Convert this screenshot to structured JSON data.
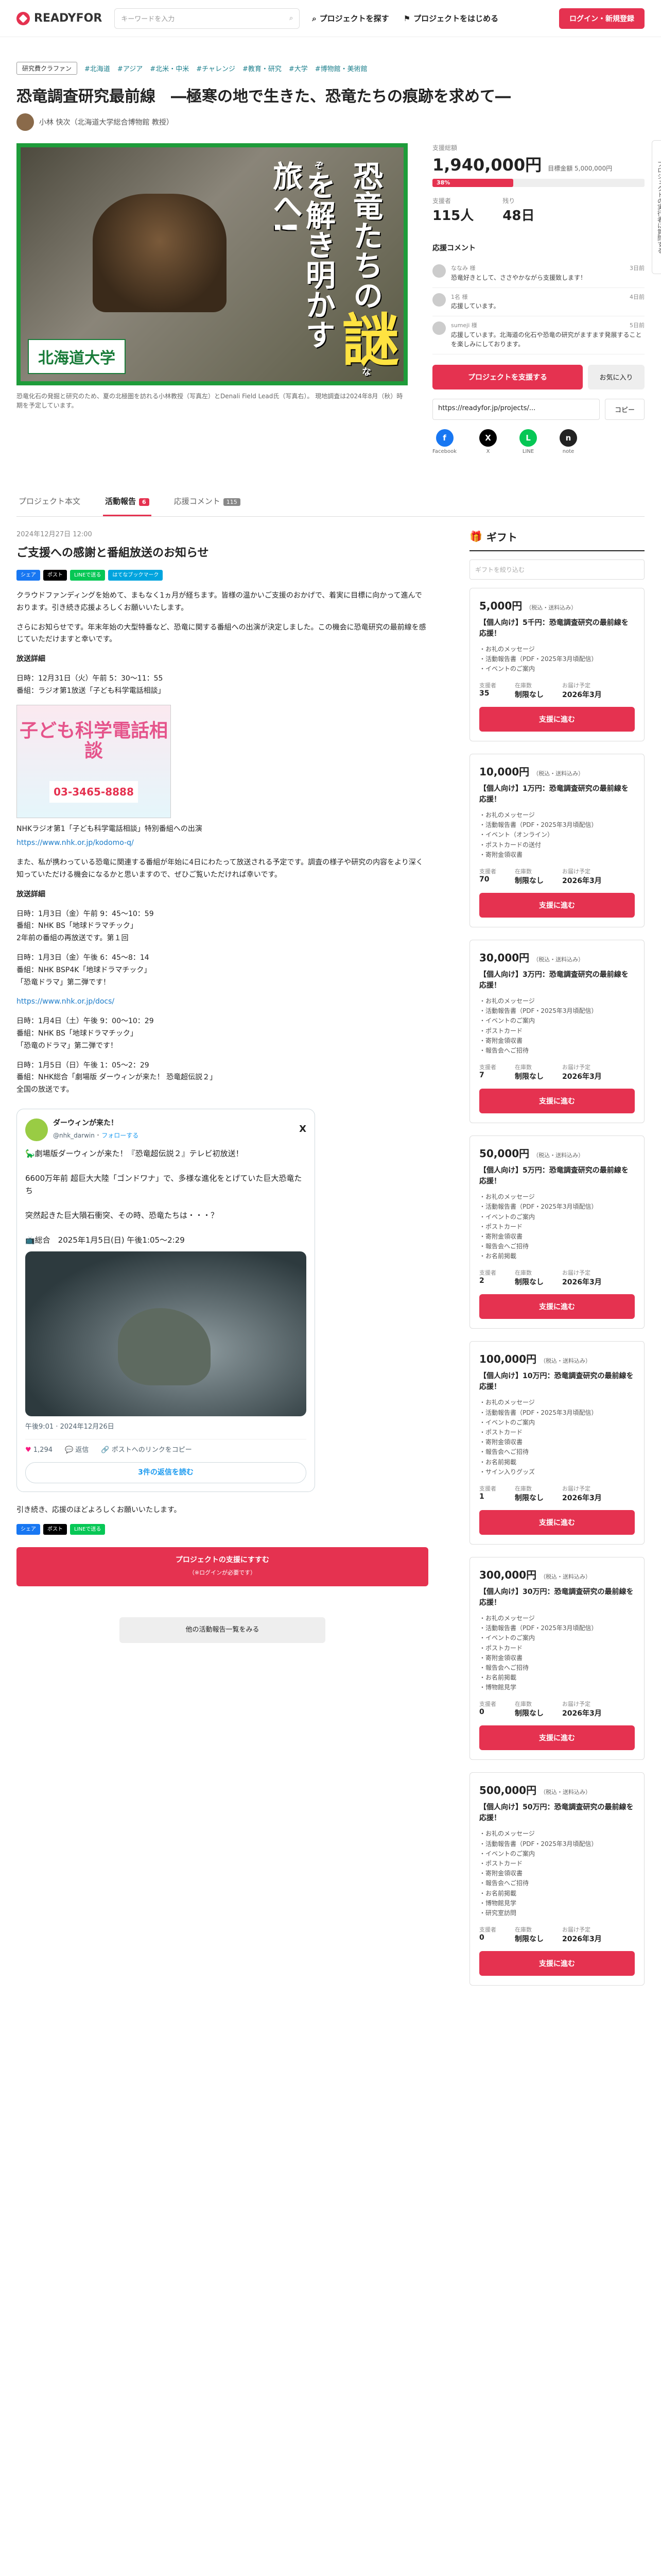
{
  "header": {
    "logo": "READYFOR",
    "search_placeholder": "キーワードを入力",
    "nav": [
      "プロジェクトを探す",
      "プロジェクトをはじめる"
    ],
    "login": "ログイン・新規登録"
  },
  "project": {
    "category": "研究費クラファン",
    "tags": [
      "#北海道",
      "#アジア",
      "#北米・中米",
      "#チャレンジ",
      "#教育・研究",
      "#大学",
      "#博物館・美術館"
    ],
    "title": "恐竜調査研究最前線　―極寒の地で生きた、恐竜たちの痕跡を求めて―",
    "owner": "小林 快次（北海道大学総合博物館 教授）",
    "hero_text": [
      "恐竜たちの",
      "謎",
      "を",
      "解き明かす旅へ!"
    ],
    "hero_ruby": "なぞ",
    "hero_badge": "北海道大学",
    "caption": "恐竜化石の発掘と研究のため、夏の北極圏を訪れる小林教授（写真左）とDenali Field Lead氏（写真右）。 現地調査は2024年8月（秋）時期を予定しています。",
    "float_label": "プロジェクトの実行者に質問する"
  },
  "status": {
    "amount_label": "支援総額",
    "amount": "1,940,000円",
    "goal": "目標金額 5,000,000円",
    "percent": 38,
    "percent_text": "38%",
    "supporters_label": "支援者",
    "supporters": "115人",
    "remaining_label": "残り",
    "remaining": "48日",
    "comments_title": "応援コメント",
    "comments": [
      {
        "name": "ななみ 様",
        "time": "3日前",
        "text": "恐竜好きとして、ささやかながら支援致します！"
      },
      {
        "name": "1名 様",
        "time": "4日前",
        "text": "応援しています。"
      },
      {
        "name": "sumeji 様",
        "time": "5日前",
        "text": "応援しています。北海道の化石や恐竜の研究がますます発展することを楽しみにしております。"
      }
    ],
    "support_btn": "プロジェクトを支援する",
    "fav_btn": "お気に入り",
    "share_url": "https://readyfor.jp/projects/...",
    "copy": "コピー",
    "share": [
      "Facebook",
      "X",
      "LINE",
      "note"
    ]
  },
  "tabs": [
    {
      "label": "プロジェクト本文",
      "count": ""
    },
    {
      "label": "活動報告",
      "count": "6"
    },
    {
      "label": "応援コメント",
      "count": "115"
    }
  ],
  "article": {
    "date": "2024年12月27日 12:00",
    "title": "ご支援への感謝と番組放送のお知らせ",
    "share_tags": [
      "シェア",
      "ポスト",
      "LINEで送る",
      "はてなブックマーク"
    ],
    "p1": "クラウドファンディングを始めて、まもなく1ヵ月が経ちます。皆様の温かいご支援のおかげで、着実に目標に向かって進んでおります。引き続き応援よろしくお願いいたします。",
    "p2": "さらにお知らせです。年末年始の大型特番など、恐竜に関する番組への出演が決定しました。この機会に恐竜研究の最前線を感じていただけますと幸いです。",
    "h1": "放送詳細",
    "r1": "日時：12月31日（火）午前 5：30〜11：55\n番組：ラジオ第1放送「子ども科学電話相談」",
    "banner_title": "子ども科学電話相談",
    "banner_tel": "03-3465-8888",
    "r1b": "NHKラジオ第1「子ども科学電話相談」特別番組への出演",
    "link1": "https://www.nhk.or.jp/kodomo-q/",
    "p3": "また、私が携わっている恐竜に関連する番組が年始に4日にわたって放送される予定です。調査の様子や研究の内容をより深く知っていただける機会になるかと思いますので、ぜひご覧いただければ幸いです。",
    "h2": "放送詳細",
    "r2": "日時：1月3日（金）午前 9：45〜10：59\n番組：NHK BS「地球ドラマチック」\n2年前の番組の再放送です。第１回",
    "r3": "日時：1月3日（金）午後 6：45〜8：14\n番組：NHK BSP4K「地球ドラマチック」\n「恐竜ドラマ」第二弾です！",
    "link2": "https://www.nhk.or.jp/docs/",
    "r4": "日時：1月4日（土）午後 9：00〜10：29\n番組：NHK BS「地球ドラマチック」\n「恐竜のドラマ」第二弾です！",
    "r5": "日時：1月5日（日）午後 1：05〜2：29\n番組：NHK総合「劇場版 ダーウィンが来た！ 恐竜超伝説２」\n全国の放送です。",
    "p4": "引き続き、応援のほどよろしくお願いいたします。",
    "support_btn": "プロジェクトの支援にすすむ",
    "support_sub": "（※ログインが必要です）",
    "other_btn": "他の活動報告一覧をみる"
  },
  "tweet": {
    "name": "ダーウィンが来た！",
    "handle": "@nhk_darwin",
    "follow": "フォローする",
    "body": "🦕劇場版ダーウィンが来た！『恐竜超伝説２』テレビ初放送！\n\n6600万年前 超巨大大陸「ゴンドワナ」で、多様な進化をとげていた巨大恐竜たち\n\n突然起きた巨大隕石衝突、その時、恐竜たちは・・・？\n\n📺総合　2025年1月5日(日) 午後1:05〜2:29",
    "time": "午後9:01 · 2024年12月26日",
    "likes": "1,294",
    "reply": "返信",
    "copy": "ポストへのリンクをコピー",
    "more": "3件の返信を読む"
  },
  "gift_section": {
    "title": "ギフト",
    "search": "ギフトを絞り込む",
    "price_suffix": "（税込・送料込み）",
    "meta_labels": [
      "支援者",
      "在庫数",
      "お届け予定"
    ],
    "btn": "支援に進む",
    "gifts": [
      {
        "price": "5,000円",
        "title": "【個人向け】5千円：恐竜調査研究の最前線を応援！",
        "desc": "・お礼のメッセージ\n・活動報告書（PDF・2025年3月頃配信）\n・イベントのご案内",
        "supporters": "35",
        "stock": "制限なし",
        "delivery": "2026年3月"
      },
      {
        "price": "10,000円",
        "title": "【個人向け】1万円：恐竜調査研究の最前線を応援！",
        "desc": "・お礼のメッセージ\n・活動報告書（PDF・2025年3月頃配信）\n・イベント（オンライン）\n・ポストカードの送付\n・寄附金領収書",
        "supporters": "70",
        "stock": "制限なし",
        "delivery": "2026年3月"
      },
      {
        "price": "30,000円",
        "title": "【個人向け】3万円：恐竜調査研究の最前線を応援！",
        "desc": "・お礼のメッセージ\n・活動報告書（PDF・2025年3月頃配信）\n・イベントのご案内\n・ポストカード\n・寄附金領収書\n・報告会へご招待",
        "supporters": "7",
        "stock": "制限なし",
        "delivery": "2026年3月"
      },
      {
        "price": "50,000円",
        "title": "【個人向け】5万円：恐竜調査研究の最前線を応援！",
        "desc": "・お礼のメッセージ\n・活動報告書（PDF・2025年3月頃配信）\n・イベントのご案内\n・ポストカード\n・寄附金領収書\n・報告会へご招待\n・お名前掲載",
        "supporters": "2",
        "stock": "制限なし",
        "delivery": "2026年3月"
      },
      {
        "price": "100,000円",
        "title": "【個人向け】10万円：恐竜調査研究の最前線を応援！",
        "desc": "・お礼のメッセージ\n・活動報告書（PDF・2025年3月頃配信）\n・イベントのご案内\n・ポストカード\n・寄附金領収書\n・報告会へご招待\n・お名前掲載\n・サイン入りグッズ",
        "supporters": "1",
        "stock": "制限なし",
        "delivery": "2026年3月"
      },
      {
        "price": "300,000円",
        "title": "【個人向け】30万円：恐竜調査研究の最前線を応援！",
        "desc": "・お礼のメッセージ\n・活動報告書（PDF・2025年3月頃配信）\n・イベントのご案内\n・ポストカード\n・寄附金領収書\n・報告会へご招待\n・お名前掲載\n・博物館見学",
        "supporters": "0",
        "stock": "制限なし",
        "delivery": "2026年3月"
      },
      {
        "price": "500,000円",
        "title": "【個人向け】50万円：恐竜調査研究の最前線を応援！",
        "desc": "・お礼のメッセージ\n・活動報告書（PDF・2025年3月頃配信）\n・イベントのご案内\n・ポストカード\n・寄附金領収書\n・報告会へご招待\n・お名前掲載\n・博物館見学\n・研究室訪問",
        "supporters": "0",
        "stock": "制限なし",
        "delivery": "2026年3月"
      }
    ]
  }
}
